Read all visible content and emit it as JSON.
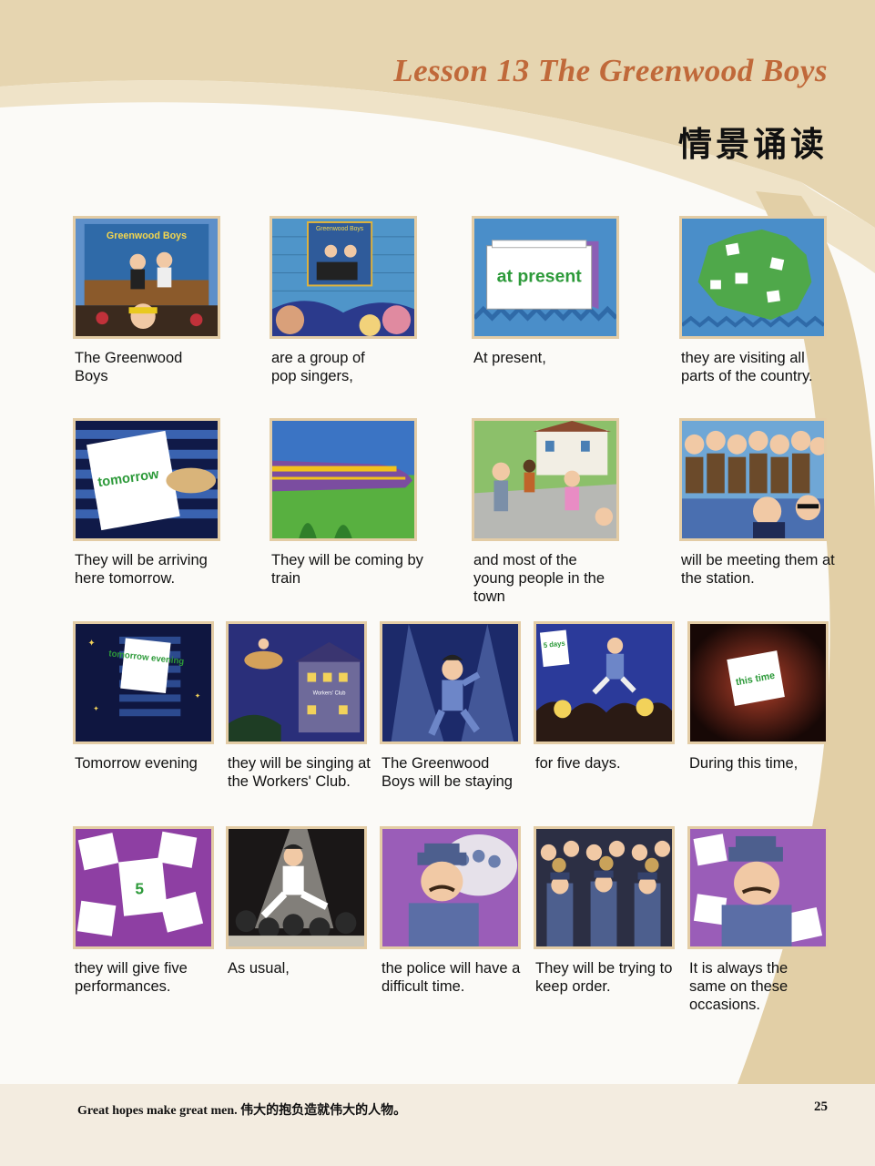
{
  "header": {
    "lesson_title": "Lesson 13  The Greenwood Boys",
    "section_title": "情景诵读"
  },
  "panels": [
    {
      "caption": "The Greenwood Boys",
      "illustration": "band-poster-icon",
      "sign": "Greenwood Boys"
    },
    {
      "caption": "are a group of pop singers,",
      "illustration": "band-billboard-icon",
      "sign": "Greenwood Boys"
    },
    {
      "caption": "At present,",
      "illustration": "calendar-icon",
      "sign": "at present"
    },
    {
      "caption": "they are visiting all parts of the country.",
      "illustration": "map-icon"
    },
    {
      "caption": "They will be arriving here tomorrow.",
      "illustration": "calendar-icon",
      "sign": "tomorrow"
    },
    {
      "caption": "They will be coming by train",
      "illustration": "train-icon"
    },
    {
      "caption": "and most of the young people in the town",
      "illustration": "town-people-icon"
    },
    {
      "caption": "will be meeting them at the station.",
      "illustration": "crowd-icon"
    },
    {
      "caption": "Tomorrow evening",
      "illustration": "calendar-icon",
      "sign": "tomorrow evening"
    },
    {
      "caption": "they will be singing at the Workers' Club.",
      "illustration": "club-building-icon",
      "sign": "Workers' Club"
    },
    {
      "caption": "The Greenwood Boys will be staying",
      "illustration": "singer-icon"
    },
    {
      "caption": "for five days.",
      "illustration": "calendar-icon",
      "sign": "5 days"
    },
    {
      "caption": "During this time,",
      "illustration": "calendar-icon",
      "sign": "this time"
    },
    {
      "caption": "they will give five performances.",
      "illustration": "photos-icon",
      "sign": "5"
    },
    {
      "caption": "As usual,",
      "illustration": "singer-icon"
    },
    {
      "caption": "the police will have a difficult time.",
      "illustration": "police-icon"
    },
    {
      "caption": "They will be trying to keep order.",
      "illustration": "police-line-icon"
    },
    {
      "caption": "It is always the same on these occasions.",
      "illustration": "police-icon"
    }
  ],
  "footer": {
    "motto": "Great hopes make great men. 伟大的抱负造就伟大的人物。",
    "page_number": "25"
  },
  "colors": {
    "title": "#c0693a",
    "page_background": "#f7f3ea",
    "swoosh": "#e2cfa6",
    "frame": "#e3cca5"
  }
}
